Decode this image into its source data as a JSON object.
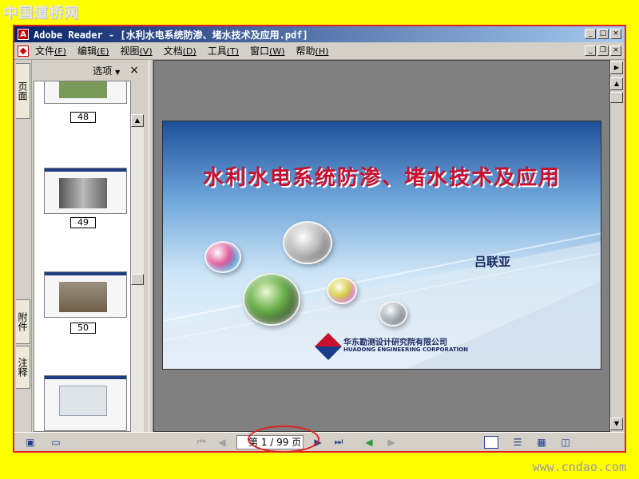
{
  "watermark": {
    "top": "中国道桥网",
    "bottom": "www.cndao.com"
  },
  "window": {
    "title": "Adobe Reader - [水利水电系统防渗、堵水技术及应用.pdf]",
    "buttons": [
      "_",
      "□",
      "×"
    ]
  },
  "menu": {
    "items": [
      {
        "label": "文件",
        "accel": "(F)"
      },
      {
        "label": "编辑",
        "accel": "(E)"
      },
      {
        "label": "视图",
        "accel": "(V)"
      },
      {
        "label": "文档",
        "accel": "(D)"
      },
      {
        "label": "工具",
        "accel": "(T)"
      },
      {
        "label": "窗口",
        "accel": "(W)"
      },
      {
        "label": "帮助",
        "accel": "(H)"
      }
    ]
  },
  "sidebar": {
    "tabs": {
      "pages": "页面",
      "attachments": "附件",
      "comments": "注释"
    },
    "options_label": "选项",
    "close_label": "×",
    "thumbnails": [
      {
        "page": "48",
        "tint": "#7a9a5a"
      },
      {
        "page": "49",
        "tint": "#8a8f8a"
      },
      {
        "page": "50",
        "tint": "#7f6f5a"
      },
      {
        "page": "",
        "tint": "#b0b8c8"
      }
    ]
  },
  "slide": {
    "title": "水利水电系统防渗、堵水技术及应用",
    "author": "吕联亚",
    "org_cn": "华东勘测设计研究院有限公司",
    "org_en": "HUADONG ENGINEERING CORPORATION"
  },
  "navigation": {
    "page_display": "第 1 / 99 页",
    "current_page": 1,
    "total_pages": 99
  },
  "icons": {
    "first": "first-page-icon",
    "prev": "previous-page-icon",
    "next": "next-page-icon",
    "last": "last-page-icon",
    "back": "go-back-icon",
    "forward": "go-forward-icon"
  },
  "colors": {
    "window_border_highlight": "#e02020",
    "title_text": "#c8102e",
    "titlebar": "#0a246a"
  }
}
